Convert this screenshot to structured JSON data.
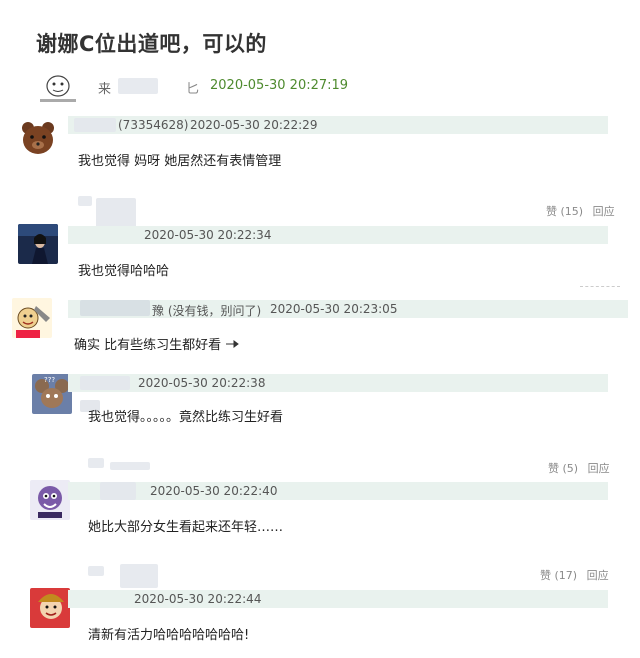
{
  "post": {
    "title": "谢娜C位出道吧，可以的",
    "author_name": "来",
    "author_name_tail": "匕",
    "time": "2020-05-30 20:27:19"
  },
  "comments": [
    {
      "user_tail": "(73354628)",
      "time": "2020-05-30 20:22:29",
      "text": "我也觉得 妈呀 她居然还有表情管理",
      "avatar": "bear-avatar"
    },
    {
      "user_tail": "",
      "time": "2020-05-30 20:22:34",
      "text": "我也觉得哈哈哈",
      "avatar": "singer-avatar",
      "like": "赞 (15)",
      "reply": "回应"
    },
    {
      "user_tail": "豫 (没有钱，别问了)",
      "time": "2020-05-30 20:23:05",
      "text": "确实 比有些练习生都好看",
      "avatar": "cartoon-chef-avatar"
    },
    {
      "user_tail": "",
      "time": "2020-05-30 20:22:38",
      "text": "我也觉得。。。。。竟然比练习生好看",
      "avatar": "mouse-cartoon-avatar"
    },
    {
      "user_tail": "",
      "time": "2020-05-30 20:22:40",
      "text": "她比大部分女生看起来还年轻……",
      "avatar": "purple-cartoon-avatar",
      "like": "赞 (5)",
      "reply": "回应"
    },
    {
      "user_tail": "",
      "time": "2020-05-30 20:22:44",
      "text": "清新有活力哈哈哈哈哈哈哈!",
      "avatar": "red-cartoon-avatar",
      "like": "赞 (17)",
      "reply": "回应"
    }
  ]
}
